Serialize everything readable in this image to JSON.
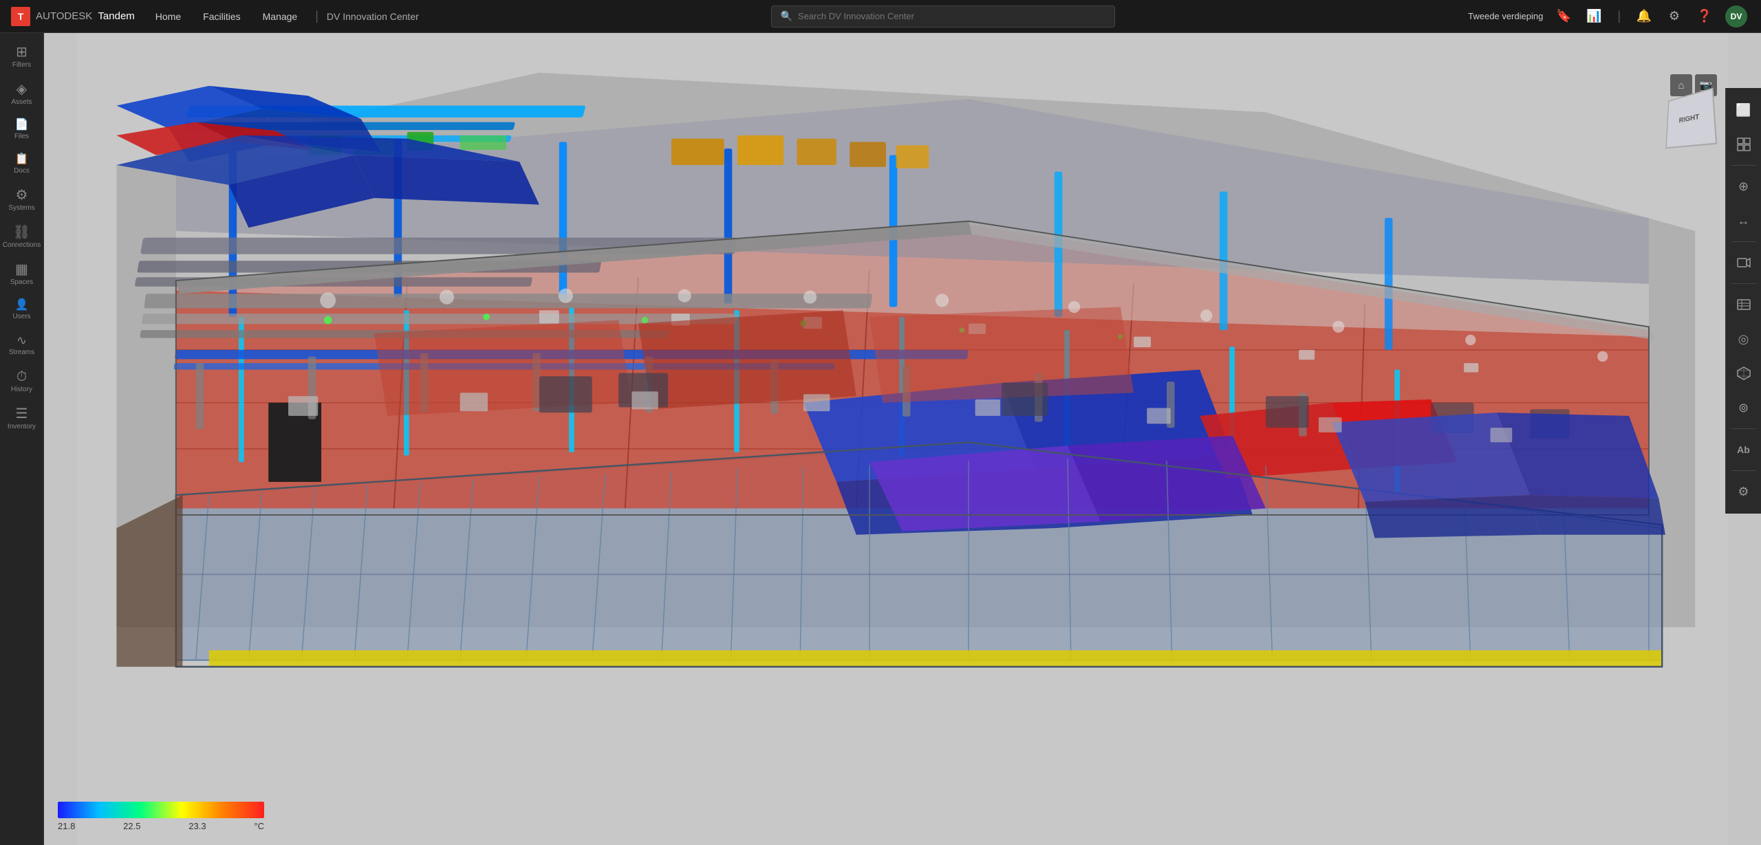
{
  "app": {
    "name": "AUTODESK",
    "product": "Tandem",
    "logo_letter": "T"
  },
  "nav": {
    "items": [
      "Home",
      "Facilities",
      "Manage"
    ],
    "divider": "|",
    "facility": "DV Innovation Center"
  },
  "search": {
    "placeholder": "Search DV Innovation Center"
  },
  "topbar_right": {
    "floor_label": "Tweede verdieping",
    "user_initials": "DV",
    "icons": [
      "bookmark",
      "chart",
      "bell",
      "question-circle",
      "help-circle",
      "user-circle"
    ]
  },
  "sidebar": {
    "items": [
      {
        "id": "filters",
        "label": "Filters",
        "icon": "⊞"
      },
      {
        "id": "assets",
        "label": "Assets",
        "icon": "◈"
      },
      {
        "id": "files",
        "label": "Files",
        "icon": "📄"
      },
      {
        "id": "docs",
        "label": "Docs",
        "icon": "📋"
      },
      {
        "id": "systems",
        "label": "Systems",
        "icon": "⚙"
      },
      {
        "id": "connections",
        "label": "Connections",
        "icon": "⛓"
      },
      {
        "id": "spaces",
        "label": "Spaces",
        "icon": "▦"
      },
      {
        "id": "users",
        "label": "Users",
        "icon": "👤"
      },
      {
        "id": "streams",
        "label": "Streams",
        "icon": "∿"
      },
      {
        "id": "history",
        "label": "History",
        "icon": "⏱"
      },
      {
        "id": "inventory",
        "label": "Inventory",
        "icon": "☰"
      }
    ]
  },
  "color_legend": {
    "min_value": "21.8",
    "mid1_value": "22.5",
    "mid2_value": "23.3",
    "unit": "°C",
    "gradient_start": "#1a1aff",
    "gradient_end": "#ff2020"
  },
  "right_toolbar": {
    "buttons": [
      {
        "id": "layout",
        "icon": "⬜",
        "label": "layout"
      },
      {
        "id": "grid",
        "icon": "⊞",
        "label": "grid"
      },
      {
        "id": "connect",
        "icon": "⊕",
        "label": "connect"
      },
      {
        "id": "move",
        "icon": "↔",
        "label": "move"
      },
      {
        "id": "video",
        "icon": "▶",
        "label": "video"
      },
      {
        "id": "table",
        "icon": "⊟",
        "label": "table"
      },
      {
        "id": "globe",
        "icon": "◎",
        "label": "globe"
      },
      {
        "id": "box3d",
        "icon": "⬡",
        "label": "box3d"
      },
      {
        "id": "layers",
        "icon": "⊚",
        "label": "layers"
      },
      {
        "id": "text",
        "icon": "Ab",
        "label": "text"
      },
      {
        "id": "settings",
        "icon": "⚙",
        "label": "settings"
      }
    ]
  },
  "viewcube": {
    "label": "RIGHT"
  },
  "view_controls": {
    "home": "⌂",
    "camera": "📷"
  }
}
